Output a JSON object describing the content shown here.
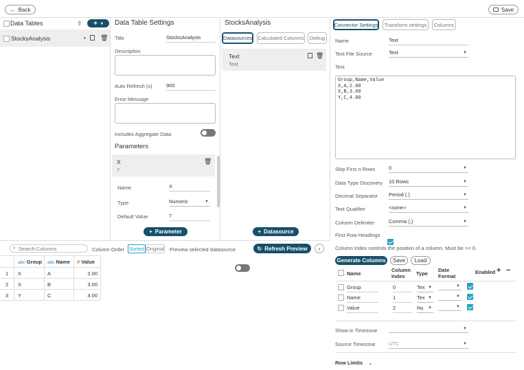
{
  "topbar": {
    "back_label": "Back",
    "save_label": "Save"
  },
  "left": {
    "title": "Data Tables",
    "items": [
      {
        "label": "StocksAnalysis"
      }
    ]
  },
  "settings": {
    "heading": "Data Table Settings",
    "title_label": "Title",
    "title_value": "StocksAnalysis",
    "description_label": "Description",
    "auto_refresh_label": "Auto Refresh (s)",
    "auto_refresh_value": "900",
    "error_message_label": "Error Message",
    "aggregate_label": "Includes Aggregate Data",
    "parameters_heading": "Parameters",
    "param": {
      "name": "X",
      "value": "7",
      "name_label": "Name",
      "name_value": "X",
      "type_label": "Type",
      "type_value": "Numeric",
      "default_label": "Default Value",
      "default_value": "7"
    },
    "add_parameter_label": "Parameter"
  },
  "datasources": {
    "heading": "StocksAnalysis",
    "tabs": [
      "Datasources",
      "Calculated Columns",
      "Debug"
    ],
    "item": {
      "name": "Text",
      "type": "Text"
    },
    "add_label": "Datasource"
  },
  "connector": {
    "tabs": [
      "Connector Settings",
      "Transform settings",
      "Columns"
    ],
    "name_label": "Name",
    "name_value": "Text",
    "source_label": "Text File Source",
    "source_value": "Text",
    "text_label": "Text",
    "text_value": "Group,Name,Value\nX,A,2.00\nX,B,3.00\nY,C,4.00",
    "skip_label": "Skip First n Rows",
    "skip_value": "0",
    "discovery_label": "Data Type Discovery",
    "discovery_value": "10 Rows",
    "decimal_label": "Decimal Separator",
    "decimal_value": "Period (.)",
    "qualifier_label": "Text Qualifier",
    "qualifier_value": "<none>",
    "delimiter_label": "Column Delimiter",
    "delimiter_value": "Comma (,)",
    "headings_label": "First Row Headings",
    "note": "Column Index controls the position of a column, Must be >= 0.",
    "generate_label": "Generate Columns",
    "save_label": "Save",
    "load_label": "Load",
    "col_headers": {
      "name": "Name",
      "index": "Column Index",
      "type": "Type",
      "date": "Date Format",
      "enabled": "Enabled"
    },
    "columns": [
      {
        "name": "Group",
        "index": "0",
        "type": "Tex"
      },
      {
        "name": "Name",
        "index": "1",
        "type": "Tex"
      },
      {
        "name": "Value",
        "index": "2",
        "type": "Nu"
      }
    ],
    "timezone_label": "Show in Timezone",
    "source_tz_label": "Source Timezone",
    "source_tz_value": "UTC",
    "row_limits_label": "Row Limits"
  },
  "preview": {
    "search_placeholder": "Search Columns",
    "column_order_label": "Column Order",
    "sorted_label": "Sorted",
    "original_label": "Original",
    "preview_label": "Preview selected datasource",
    "refresh_label": "Refresh Preview",
    "headers": [
      {
        "prefix": "abc",
        "label": "Group"
      },
      {
        "prefix": "abc",
        "label": "Name"
      },
      {
        "prefix": "#",
        "label": "Value"
      }
    ],
    "rows": [
      [
        "1",
        "X",
        "A",
        "2.00"
      ],
      [
        "2",
        "X",
        "B",
        "3.00"
      ],
      [
        "3",
        "Y",
        "C",
        "4.00"
      ]
    ]
  }
}
